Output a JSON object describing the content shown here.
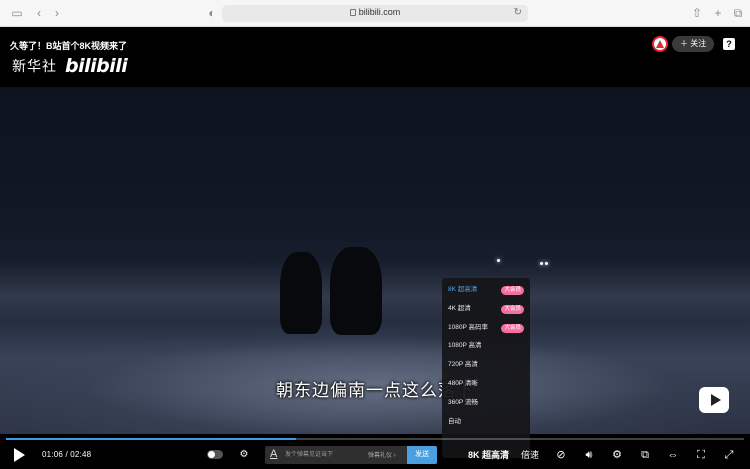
{
  "browser": {
    "url": "bilibili.com"
  },
  "player": {
    "title": "久等了！B站首个8K视频来了",
    "logo_text": "新华社",
    "logo_brand": "bilibili",
    "follow_label": "＋ 关注",
    "help_label": "?",
    "subtitle": "朝东边偏南一点这么落下",
    "quality_menu": {
      "items": [
        {
          "label": "8K 超高清",
          "badge": "大会员",
          "active": true
        },
        {
          "label": "4K 超清",
          "badge": "大会员",
          "active": false
        },
        {
          "label": "1080P 高码率",
          "badge": "大会员",
          "active": false
        },
        {
          "label": "1080P 高清",
          "badge": "",
          "active": false
        },
        {
          "label": "720P 高清",
          "badge": "",
          "active": false
        },
        {
          "label": "480P 清晰",
          "badge": "",
          "active": false
        },
        {
          "label": "360P 流畅",
          "badge": "",
          "active": false
        },
        {
          "label": "自动",
          "badge": "",
          "active": false
        }
      ]
    },
    "progress": {
      "current": "01:06",
      "total": "02:48",
      "fraction": 0.393
    },
    "controls": {
      "time_text": "01:06 / 02:48",
      "danmaku_placeholder": "发个弹幕见证当下",
      "danmaku_etiquette": "弹幕礼仪 ›",
      "send_label": "发送",
      "quality_label": "8K 超高清",
      "speed_label": "倍速"
    },
    "colors": {
      "accent": "#3c9ae8",
      "vip_badge": "#f46f9d"
    }
  }
}
